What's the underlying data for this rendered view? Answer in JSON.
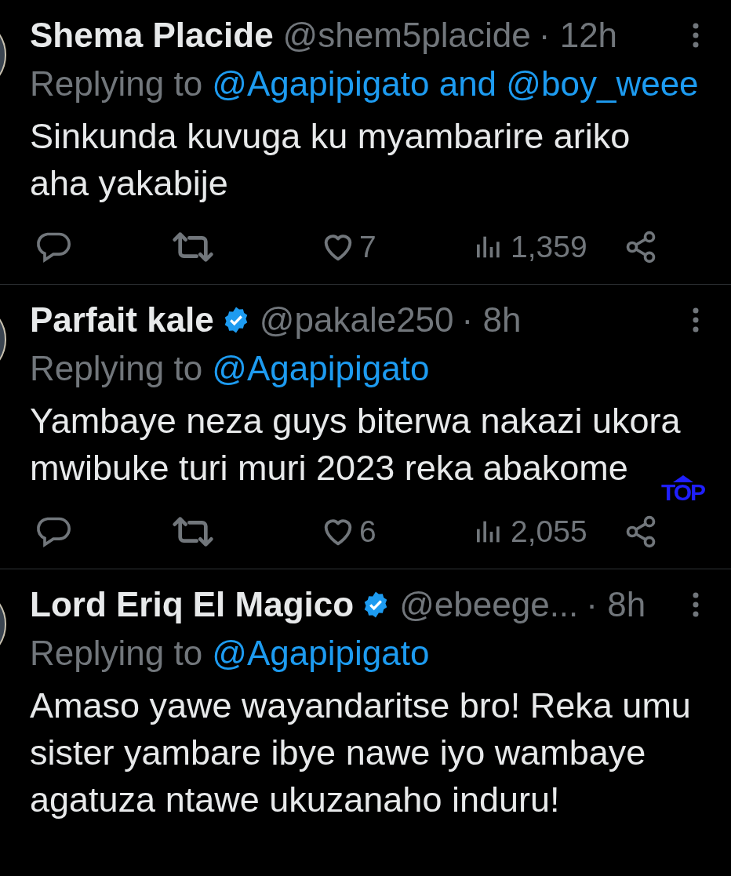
{
  "tweets": [
    {
      "name": "Shema Placide",
      "verified": false,
      "handle": "@shem5placide",
      "time": "· 12h",
      "replying_prefix": "Replying to",
      "replying_to": "@Agapipigato and @boy_weee",
      "body_lines": [
        "Sinkunda kuvuga ku myambarire ariko",
        "aha yakabije"
      ],
      "likes": "7",
      "views": "1,359",
      "actions_visible": true
    },
    {
      "name": "Parfait kale",
      "verified": true,
      "handle": "@pakale250",
      "time": "· 8h",
      "replying_prefix": "Replying to",
      "replying_to": "@Agapipigato",
      "body_lines": [
        "Yambaye neza guys biterwa nakazi ukora",
        "mwibuke turi muri 2023 reka abakome"
      ],
      "likes": "6",
      "views": "2,055",
      "actions_visible": true
    },
    {
      "name": "Lord Eriq El Magico",
      "verified": true,
      "handle": "@ebeege...",
      "time": "· 8h",
      "replying_prefix": "Replying to",
      "replying_to": "@Agapipigato",
      "body_lines": [
        "Amaso yawe wayandaritse bro! Reka umu",
        "sister yambare ibye nawe iyo wambaye",
        "agatuza ntawe ukuzanaho induru!"
      ],
      "actions_visible": false
    }
  ],
  "scroll_top_button": {
    "label": "TOP"
  }
}
